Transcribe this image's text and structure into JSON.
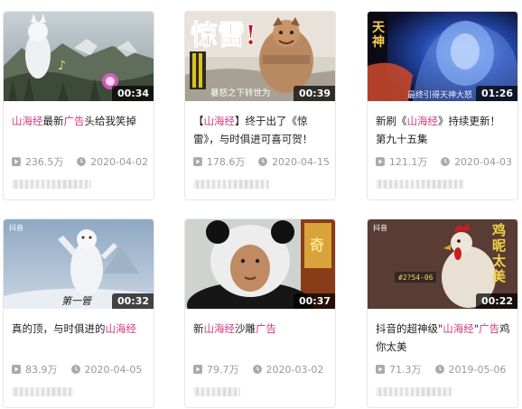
{
  "colors": {
    "highlight": "#d2387d",
    "meta_text": "#999999",
    "duration_bg": "#000000"
  },
  "videos": [
    {
      "duration": "00:34",
      "title_parts": [
        {
          "t": "山海经",
          "hl": true
        },
        {
          "t": "最新",
          "hl": false
        },
        {
          "t": "广告",
          "hl": true
        },
        {
          "t": "头给我笑掉",
          "hl": false
        }
      ],
      "views": "236.5万",
      "date": "2020-04-02",
      "thumb_text": ""
    },
    {
      "duration": "00:39",
      "title_parts": [
        {
          "t": "【",
          "hl": false
        },
        {
          "t": "山海经",
          "hl": true
        },
        {
          "t": "】终于出了《惊雷》，与时俱进可喜可贺！",
          "hl": false
        }
      ],
      "views": "178.6万",
      "date": "2020-04-15",
      "thumb_text": "惊雷!",
      "thumb_caption": "暴怒之下转世为"
    },
    {
      "duration": "01:26",
      "title_parts": [
        {
          "t": "新刷《",
          "hl": false
        },
        {
          "t": "山海经",
          "hl": true
        },
        {
          "t": "》持续更新！第九十五集",
          "hl": false
        }
      ],
      "views": "121.1万",
      "date": "2020-04-03",
      "thumb_text": "天神",
      "thumb_caption": "最终引得天神大怒"
    },
    {
      "duration": "00:32",
      "title_parts": [
        {
          "t": "真的顶，与时俱进的",
          "hl": false
        },
        {
          "t": "山海经",
          "hl": true
        }
      ],
      "views": "83.9万",
      "date": "2020-04-05",
      "thumb_text": "第一管",
      "thumb_logo": "抖音"
    },
    {
      "duration": "00:37",
      "title_parts": [
        {
          "t": "新",
          "hl": false
        },
        {
          "t": "山海经",
          "hl": true
        },
        {
          "t": "沙雕",
          "hl": false
        },
        {
          "t": "广告",
          "hl": true
        }
      ],
      "views": "79.7万",
      "date": "2020-03-02",
      "thumb_text": "奇"
    },
    {
      "duration": "00:22",
      "title_parts": [
        {
          "t": "抖音的超神级\"",
          "hl": false
        },
        {
          "t": "山海经",
          "hl": true
        },
        {
          "t": "\"",
          "hl": false
        },
        {
          "t": "广告",
          "hl": true
        },
        {
          "t": "鸡你太美",
          "hl": false
        }
      ],
      "views": "71.3万",
      "date": "2019-05-06",
      "thumb_text": "鸡\n昵\n太\n美",
      "thumb_logo": "抖音"
    }
  ]
}
